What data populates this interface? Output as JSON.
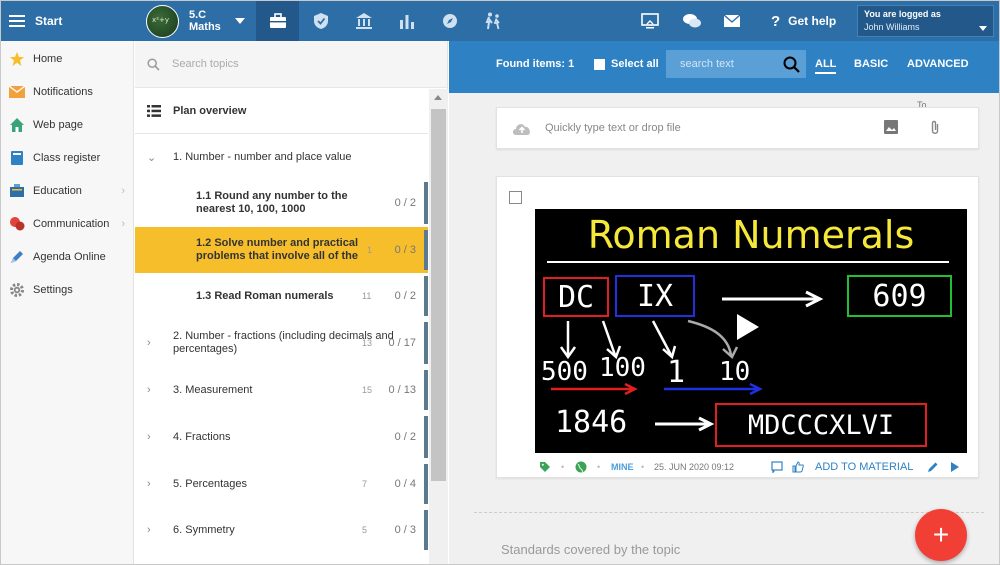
{
  "topbar": {
    "start_label": "Start",
    "class_name_line1": "5.C",
    "class_name_line2": "Maths",
    "help_label": "Get help",
    "logged_in_label": "You are logged as",
    "user_name": "John Williams"
  },
  "left_nav": {
    "items": [
      {
        "label": "Home",
        "icon": "star-icon"
      },
      {
        "label": "Notifications",
        "icon": "envelope-icon"
      },
      {
        "label": "Web page",
        "icon": "house-icon"
      },
      {
        "label": "Class register",
        "icon": "book-icon"
      },
      {
        "label": "Education",
        "icon": "education-icon"
      },
      {
        "label": "Communication",
        "icon": "chat-icon"
      },
      {
        "label": "Agenda Online",
        "icon": "pen-icon"
      },
      {
        "label": "Settings",
        "icon": "gear-icon"
      }
    ]
  },
  "topics": {
    "search_placeholder": "Search topics",
    "plan_overview": "Plan overview",
    "rows": [
      {
        "title": "1. Number - number and place value",
        "count": "",
        "ratio": "",
        "expanded": true
      },
      {
        "title": "1.1  Round any number to the nearest 10, 100, 1000",
        "count": "",
        "ratio": "0 / 2"
      },
      {
        "title": "1.2  Solve number and practical problems that involve all of the",
        "count": "1",
        "ratio": "0 / 3",
        "selected": true
      },
      {
        "title": "1.3  Read Roman numerals",
        "count": "11",
        "ratio": "0 / 2"
      },
      {
        "title": "2. Number - fractions (including decimals and percentages)",
        "count": "13",
        "ratio": "0 / 17"
      },
      {
        "title": "3. Measurement",
        "count": "15",
        "ratio": "0 / 13"
      },
      {
        "title": "4. Fractions",
        "count": "",
        "ratio": "0 / 2"
      },
      {
        "title": "5. Percentages",
        "count": "7",
        "ratio": "0 / 4"
      },
      {
        "title": "6. Symmetry",
        "count": "5",
        "ratio": "0 / 3"
      }
    ]
  },
  "main": {
    "found_items": "Found items: 1",
    "select_all": "Select all",
    "search_placeholder": "search text",
    "filters": [
      "ALL",
      "BASIC",
      "ADVANCED"
    ],
    "quick_input_placeholder": "Quickly type text or drop file",
    "tb_peek": "To",
    "material": {
      "video_title": "Roman Numerals",
      "mine_label": "MINE",
      "date": "25. JUN 2020 09:12",
      "add_label": "ADD TO MATERIAL",
      "row1": [
        "DC",
        "IX",
        "609"
      ],
      "row2": [
        "500",
        "100",
        "1",
        "10"
      ],
      "row3": [
        "1846",
        "MDCCCXLVI"
      ]
    },
    "standards_label": "Standards covered by the topic",
    "fab_label": "+"
  },
  "colors": {
    "topbar": "#2e6ea6",
    "filter_bar": "#2e82c4",
    "selected_topic": "#f7be2c",
    "fab": "#f13f36"
  }
}
